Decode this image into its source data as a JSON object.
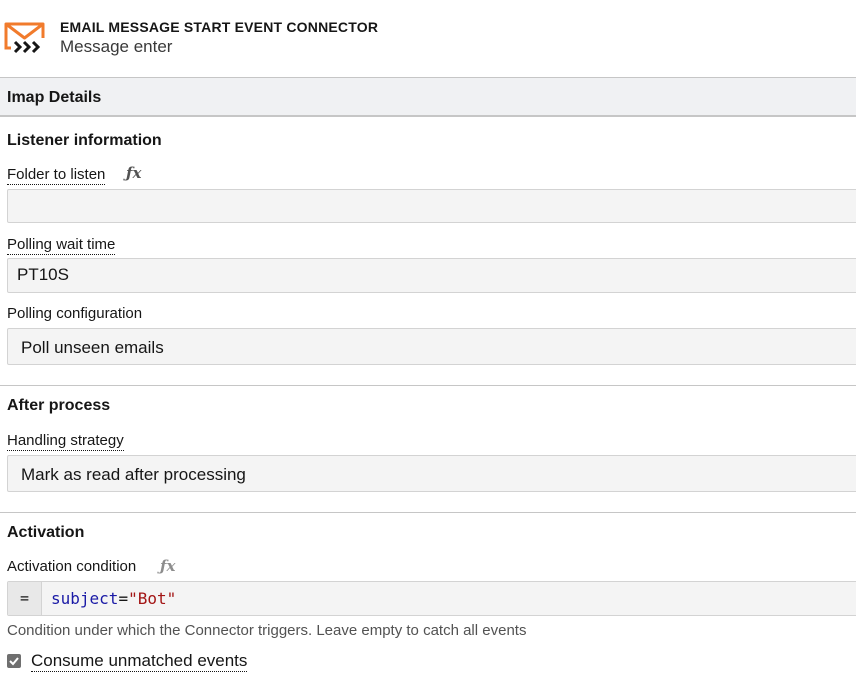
{
  "header": {
    "type_label": "EMAIL MESSAGE START EVENT CONNECTOR",
    "element_name": "Message enter",
    "icon": "email-connector-icon",
    "accent_color": "#f17b2c",
    "icon_dark_color": "#161616"
  },
  "group": {
    "title": "Imap Details"
  },
  "listener": {
    "title": "Listener information",
    "folder": {
      "label": "Folder to listen",
      "value": ""
    },
    "polling_wait": {
      "label": "Polling wait time",
      "value": "PT10S"
    },
    "polling_config": {
      "label": "Polling configuration",
      "value": "Poll unseen emails"
    }
  },
  "after_process": {
    "title": "After process",
    "handling": {
      "label": "Handling strategy",
      "value": "Mark as read after processing"
    }
  },
  "activation": {
    "title": "Activation",
    "condition": {
      "label": "Activation condition",
      "eq": "=",
      "code_key": "subject",
      "code_op": "=",
      "code_value": "\"Bot\"",
      "help": "Condition under which the Connector triggers. Leave empty to catch all events"
    },
    "consume": {
      "label": "Consume unmatched events",
      "checked": true
    }
  },
  "colors": {
    "fx_dark": "#525252",
    "fx_light": "#8d8d8d",
    "code_key": "#1a1aa6",
    "code_string": "#a31515"
  }
}
